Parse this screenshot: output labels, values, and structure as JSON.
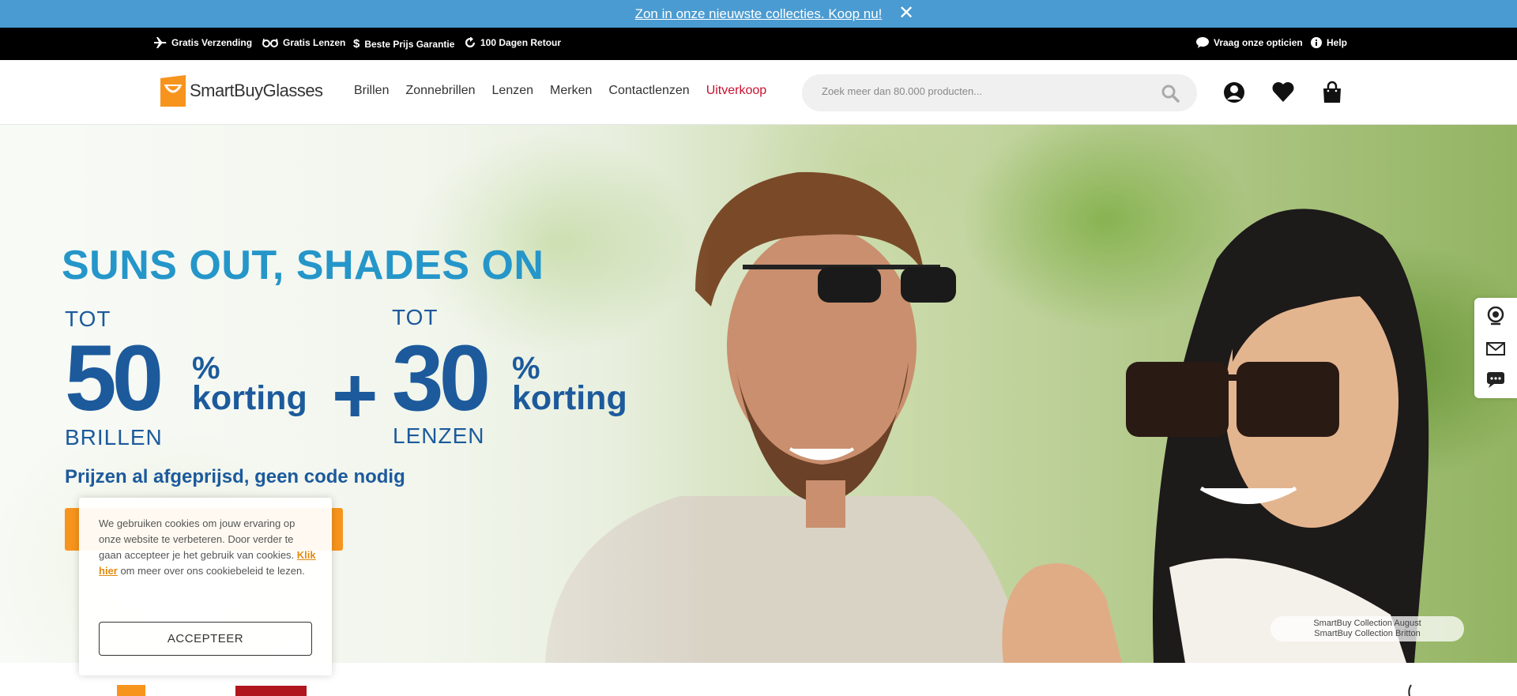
{
  "promo": {
    "text": "Zon in onze nieuwste collecties. Koop nu!",
    "close_label": "✕"
  },
  "usp": {
    "items": [
      {
        "label": "Gratis Verzending",
        "icon": "airplane-icon"
      },
      {
        "label": "Gratis Lenzen",
        "icon": "glasses-icon"
      },
      {
        "label": "Beste Prijs Garantie",
        "icon": "dollar-icon"
      },
      {
        "label": "100 Dagen Retour",
        "icon": "return-icon"
      }
    ],
    "right": [
      {
        "label": "Vraag onze opticien",
        "icon": "chat-icon"
      },
      {
        "label": "Help",
        "icon": "info-icon"
      }
    ]
  },
  "header": {
    "logo": "SmartBuyGlasses",
    "nav": [
      "Brillen",
      "Zonnebrillen",
      "Lenzen",
      "Merken",
      "Contactlenzen",
      "Uitverkoop"
    ],
    "search_placeholder": "Zoek meer dan 80.000 producten...",
    "icons": [
      "account-icon",
      "heart-icon",
      "bag-icon"
    ]
  },
  "hero": {
    "title": "SUNS OUT, SHADES ON",
    "left": {
      "tot": "TOT",
      "number": "50",
      "pct": "%",
      "korting": "korting",
      "label": "BRILLEN"
    },
    "plus": "+",
    "right": {
      "tot": "TOT",
      "number": "30",
      "pct": "%",
      "korting": "korting",
      "label": "LENZEN"
    },
    "tagline": "Prijzen al afgeprijsd, geen code nodig",
    "caption_line1": "SmartBuy Collection August",
    "caption_line2": "SmartBuy Collection Britton"
  },
  "side_widget": [
    "webcam-icon",
    "mail-icon",
    "chat-bubble-icon"
  ],
  "cookie": {
    "text_before": "We gebruiken cookies om jouw ervaring op onze website te verbeteren. Door verder te gaan accepteer je het gebruik van cookies. ",
    "link": "Klik hier",
    "text_after": " om meer over ons cookiebeleid te lezen.",
    "button": "ACCEPTEER"
  },
  "colors": {
    "promo": "#4a9bd1",
    "title": "#2596c9",
    "headline": "#1c5a9c",
    "cta": "#f7941d",
    "sale": "#c8102e"
  }
}
